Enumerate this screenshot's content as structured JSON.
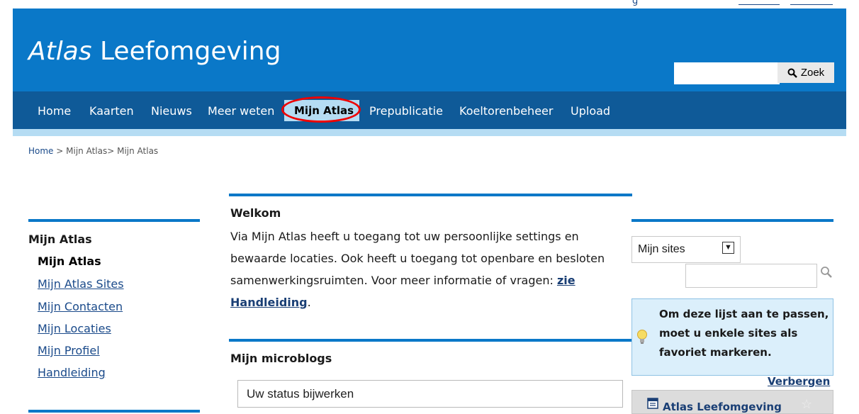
{
  "header": {
    "logo_italic": "Atlas",
    "logo_rest": " Leefomgeving",
    "search_placeholder": "",
    "search_button_label": "Zoek"
  },
  "nav": {
    "items": [
      "Home",
      "Kaarten",
      "Nieuws",
      "Meer weten",
      "Mijn Atlas",
      "Prepublicatie",
      "Koeltorenbeheer",
      "Upload"
    ],
    "active_index": 4
  },
  "breadcrumb": {
    "home": "Home",
    "sep": " > ",
    "mid": "Mijn Atlas",
    "last": "> Mijn Atlas"
  },
  "left_nav": {
    "title": "Mijn Atlas",
    "items": [
      "Mijn Atlas",
      "Mijn Atlas Sites",
      "Mijn Contacten",
      "Mijn Locaties",
      "Mijn Profiel",
      "Handleiding"
    ]
  },
  "welcome": {
    "title": "Welkom",
    "body": "Via Mijn Atlas heeft u toegang tot uw persoonlijke settings en bewaarde locaties. Ook heeft u toegang tot openbare en besloten samenwerkingsruimten. Voor meer informatie of vragen: ",
    "link": "zie Handleiding",
    "end": "."
  },
  "microblog": {
    "title": "Mijn microblogs",
    "status_value": "Uw status bijwerken"
  },
  "sites": {
    "select_value": "Mijn sites",
    "info_text": "Om deze lijst aan te passen, moet u enkele sites als favoriet markeren.",
    "hide_link": "Verbergen",
    "site_title": "Atlas Leefomgeving"
  },
  "colors": {
    "header_blue": "#0a78c8",
    "nav_blue": "#0f5a98",
    "light_blue": "#b5dcf3",
    "highlight_red": "#e00000"
  }
}
